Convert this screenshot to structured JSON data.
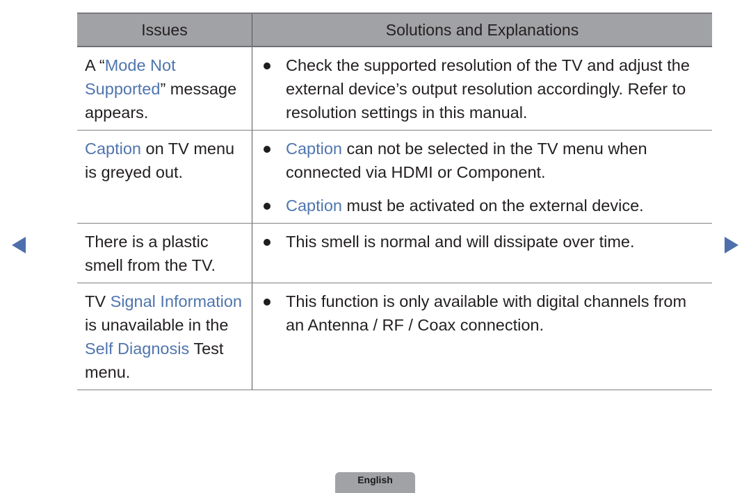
{
  "table": {
    "headers": [
      "Issues",
      "Solutions and Explanations"
    ],
    "rows": [
      {
        "issue": [
          {
            "t": "A “"
          },
          {
            "t": "Mode Not Supported",
            "hl": true
          },
          {
            "t": "” message appears."
          }
        ],
        "solutions": [
          [
            {
              "t": "Check the supported resolution of the TV and adjust the external device’s output resolution accordingly. Refer to resolution settings in this manual."
            }
          ]
        ]
      },
      {
        "issue": [
          {
            "t": "Caption",
            "hl": true
          },
          {
            "t": " on TV menu is greyed out."
          }
        ],
        "solutions": [
          [
            {
              "t": "Caption",
              "hl": true
            },
            {
              "t": " can not be selected in the TV menu when connected via HDMI or Component."
            }
          ],
          [
            {
              "t": "Caption",
              "hl": true
            },
            {
              "t": " must be activated on the external device."
            }
          ]
        ]
      },
      {
        "issue": [
          {
            "t": "There is a plastic smell from the TV."
          }
        ],
        "solutions": [
          [
            {
              "t": "This smell is normal and will dissipate over time."
            }
          ]
        ]
      },
      {
        "issue": [
          {
            "t": "TV "
          },
          {
            "t": "Signal Information",
            "hl": true
          },
          {
            "t": " is unavailable in the "
          },
          {
            "t": "Self Diagnosis",
            "hl": true
          },
          {
            "t": " Test menu."
          }
        ],
        "solutions": [
          [
            {
              "t": "This function is only available with digital channels from an Antenna / RF / Coax connection."
            }
          ]
        ]
      }
    ]
  },
  "nav": {
    "prev_icon": "triangle-left",
    "next_icon": "triangle-right"
  },
  "footer": {
    "language_label": "English"
  },
  "colors": {
    "highlight": "#4f75ae",
    "header_bg": "#a1a2a5",
    "arrow": "#4e6fab"
  }
}
